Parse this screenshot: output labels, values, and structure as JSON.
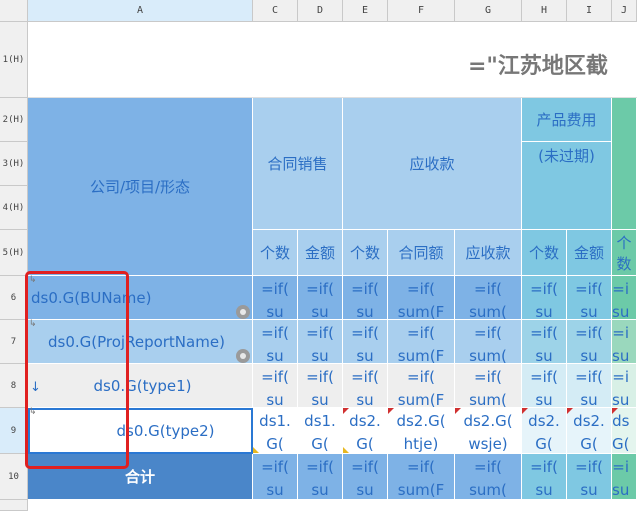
{
  "column_headers": [
    "A",
    "C",
    "D",
    "E",
    "F",
    "G",
    "H",
    "I",
    "J"
  ],
  "row_headers": [
    "1(H)",
    "2(H)",
    "3(H)",
    "4(H)",
    "5(H)",
    "6",
    "7",
    "8",
    "9",
    "10"
  ],
  "title_formula": "=\"江苏地区截",
  "header": {
    "company_project_form": "公司/项目/形态",
    "contract_sales": "合同销售",
    "receivables": "应收款",
    "product_cost": "产品费用",
    "not_overdue": "(未过期)",
    "sub": [
      "个数",
      "金额",
      "个数",
      "合同额",
      "应收款",
      "个数",
      "金额",
      "个数"
    ]
  },
  "rows": {
    "r6": {
      "label": "ds0.G(BUName)",
      "cells": [
        "=if(\nsu",
        "=if(\nsu",
        "=if(\nsu",
        "=if(\nsum(F",
        "=if(\nsum(",
        "=if(\nsu",
        "=if(\nsu",
        "=i\nsu"
      ]
    },
    "r7": {
      "label": "ds0.G(ProjReportName)",
      "cells": [
        "=if(\nsu",
        "=if(\nsu",
        "=if(\nsu",
        "=if(\nsum(F",
        "=if(\nsum(",
        "=if(\nsu",
        "=if(\nsu",
        "=i\nsu"
      ]
    },
    "r8": {
      "label": "ds0.G(type1)",
      "cells": [
        "=if(\nsu",
        "=if(\nsu",
        "=if(\nsu",
        "=if(\nsum(F",
        "=if(\nsum(",
        "=if(\nsu",
        "=if(\nsu",
        "=i\nsu"
      ]
    },
    "r9": {
      "label": "ds0.G(type2)",
      "cells": [
        "ds1.\nG(",
        "ds1.\nG(",
        "ds2.\nG(",
        "ds2.G(\nhtje)",
        "ds2.G(\nwsje)",
        "ds2.\nG(",
        "ds2.\nG(",
        "ds\nG("
      ]
    },
    "r10": {
      "label": "合计",
      "cells": [
        "=if(\nsu",
        "=if(\nsu",
        "=if(\nsu",
        "=if(\nsum(F",
        "=if(\nsum(",
        "=if(\nsu",
        "=if(\nsu",
        "=i\nsu"
      ]
    }
  },
  "colors": {
    "header_blue": "#7eb2e6",
    "total_blue": "#4a86c9",
    "highlight_red": "#e02020",
    "selection_blue": "#2a78d4"
  }
}
